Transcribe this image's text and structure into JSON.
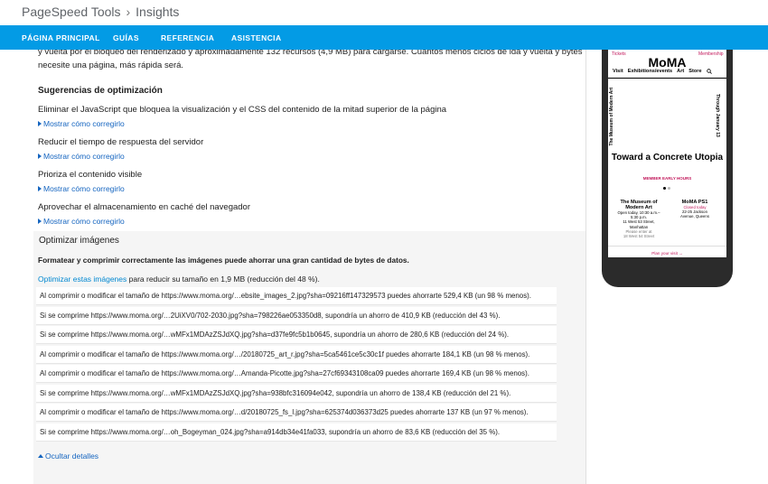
{
  "breadcrumb": {
    "root": "PageSpeed Tools",
    "separator": "›",
    "current": "Insights"
  },
  "nav": [
    "PÁGINA PRINCIPAL",
    "GUÍAS",
    "REFERENCIA",
    "ASISTENCIA"
  ],
  "intro": {
    "line1": "y vuelta por el bloqueo del renderizado y aproximadamente 132 recursos (4,9 MB) para cargarse. Cuantos menos ciclos de ida y vuelta y bytes",
    "line2": "necesite una página, más rápida será."
  },
  "suggestions": {
    "heading": "Sugerencias de optimización",
    "fix_label": "Mostrar cómo corregirlo",
    "rules": [
      "Eliminar el JavaScript que bloquea la visualización y el CSS del contenido de la mitad superior de la página",
      "Reducir el tiempo de respuesta del servidor",
      "Prioriza el contenido visible",
      "Aprovechar el almacenamiento en caché del navegador"
    ]
  },
  "images": {
    "title": "Optimizar imágenes",
    "bold_line": "Formatear y comprimir correctamente las imágenes puede ahorrar una gran cantidad de bytes de datos.",
    "link": "Optimizar estas imágenes",
    "summary": " para reducir su tamaño en 1,9 MB (reducción del 48 %).",
    "rows": [
      "Al comprimir o modificar el tamaño de https://www.moma.org/…ebsite_images_2.jpg?sha=09216ff147329573 puedes ahorrarte 529,4 KB (un 98 % menos).",
      "Si se comprime https://www.moma.org/…2UiXV0/702-2030.jpg?sha=798226ae053350d8, supondría un ahorro de 410,9 KB (reducción del 43 %).",
      "Si se comprime https://www.moma.org/…wMFx1MDAzZSJdXQ.jpg?sha=d37fe9fc5b1b0645, supondría un ahorro de 280,6 KB (reducción del 24 %).",
      "Al comprimir o modificar el tamaño de https://www.moma.org/…/20180725_art_r.jpg?sha=5ca5461ce5c30c1f puedes ahorrarte 184,1 KB (un 98 % menos).",
      "Al comprimir o modificar el tamaño de https://www.moma.org/…Amanda-Picotte.jpg?sha=27cf69343108ca09 puedes ahorrarte 169,4 KB (un 98 % menos).",
      "Si se comprime https://www.moma.org/…wMFx1MDAzZSJdXQ.jpg?sha=938bfc316094e042, supondría un ahorro de 138,4 KB (reducción del 21 %).",
      "Al comprimir o modificar el tamaño de https://www.moma.org/…d/20180725_fs_l.jpg?sha=625374d036373d25 puedes ahorrarte 137 KB (un 97 % menos).",
      "Si se comprime https://www.moma.org/…oh_Bogeyman_024.jpg?sha=a914db34e41fa033, supondría un ahorro de 83,6 KB (reducción del 35 %)."
    ],
    "hide_label": "Ocultar detalles"
  },
  "preview": {
    "tickets": "Tickets",
    "membership": "Membership",
    "logo": "MoMA",
    "nav": [
      "Visit",
      "Exhibitions/events",
      "Art",
      "Store"
    ],
    "vertical_left": "The Museum of Modern Art",
    "vertical_right": "Through January 13",
    "title": "Toward a Concrete Utopia",
    "member_hours": "MEMBER EARLY HOURS",
    "col1": {
      "title": "The Museum of Modern Art",
      "l1": "Open today, 10:30 a.m.–",
      "l2": "5:30 p.m.",
      "l3": "11 West 53 Street,",
      "l4": "Manhattan",
      "l5": "Please enter at",
      "l6": "18 West 54 Street"
    },
    "col2": {
      "title": "MoMA PS1",
      "l1": "Closed today",
      "l2": "22-25 Jackson",
      "l3": "Avenue, Queens"
    },
    "plan": "Plan your visit →"
  }
}
